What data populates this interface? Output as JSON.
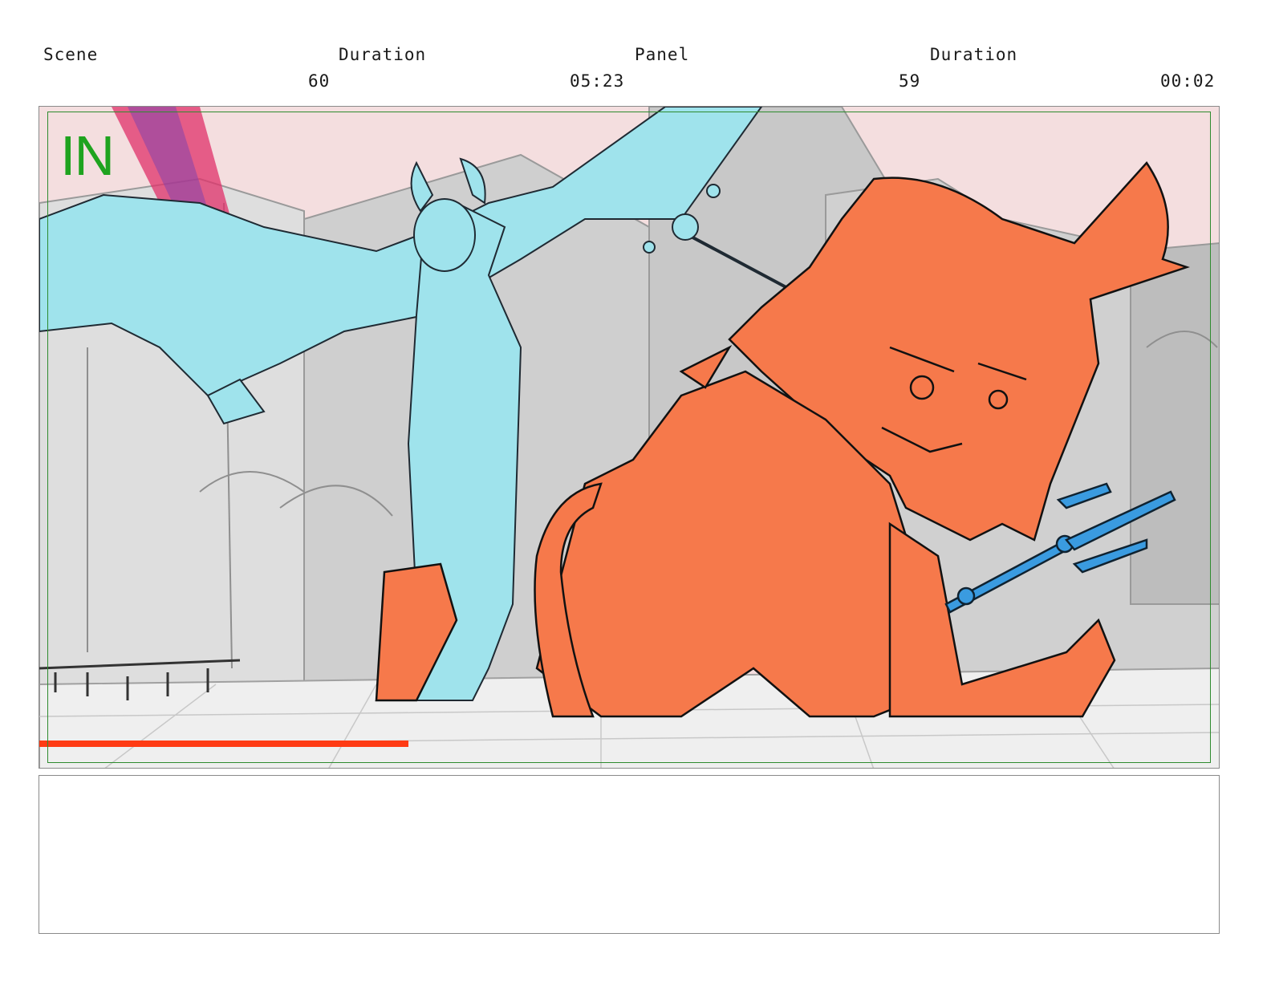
{
  "header": {
    "scene_label": "Scene",
    "scene_duration_label": "Duration",
    "panel_label": "Panel",
    "panel_duration_label": "Duration",
    "scene_value": "60",
    "scene_duration_value": "05:23",
    "panel_value": "59",
    "panel_duration_value": "00:02"
  },
  "frame": {
    "marker": "IN",
    "colors": {
      "sky": "#f4dedf",
      "demon_blue": "#9fe3ec",
      "demon_orange": "#f6794b",
      "trident_blue": "#3a9be0",
      "safe_area": "#2e8b2e",
      "marker": "#1fa31f",
      "ground_stripe": "#ff3b14"
    }
  },
  "notes": {
    "text": ""
  }
}
